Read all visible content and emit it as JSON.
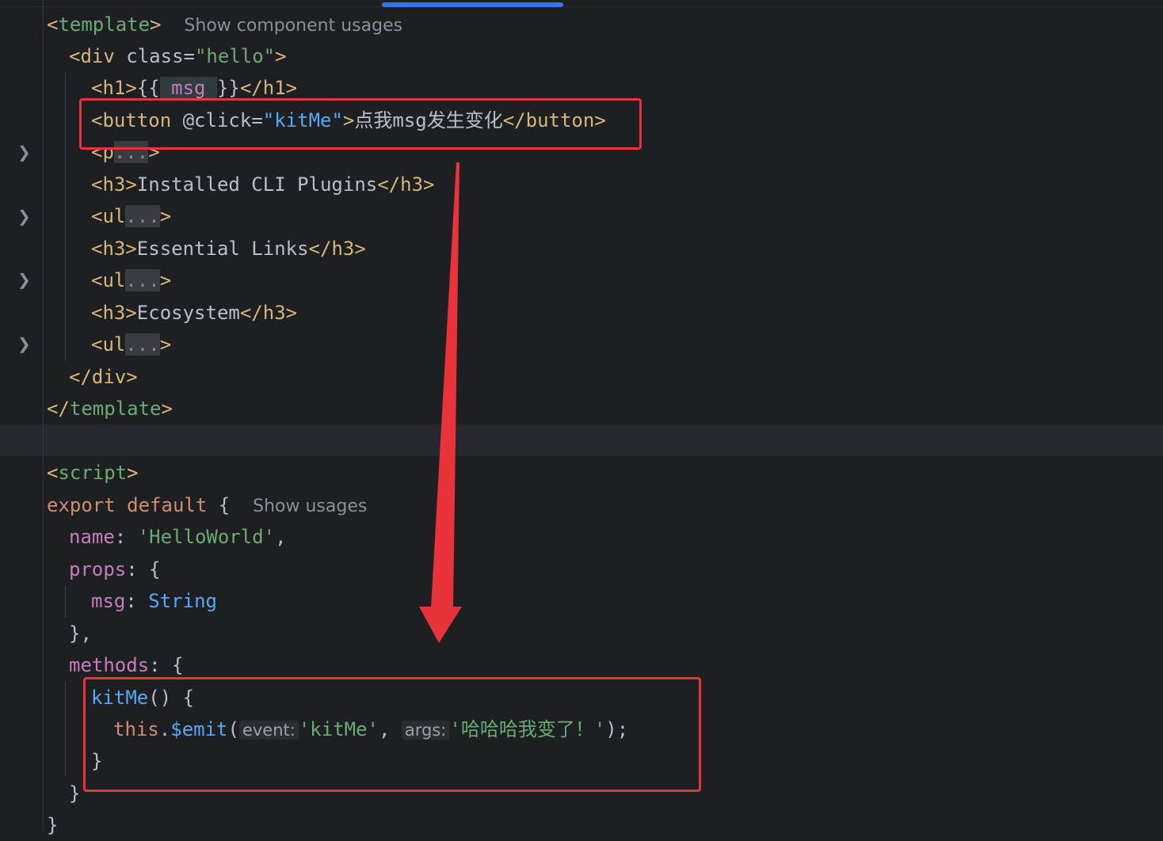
{
  "template_block": {
    "open_tag": "template",
    "hint": "Show component usages",
    "div_tag": "div",
    "div_attr": "class",
    "div_attr_value": "\"hello\"",
    "h1_open": "<h1>",
    "h1_expr_open": "{{",
    "h1_var": "msg",
    "h1_expr_close": "}}",
    "h1_close": "</h1>",
    "button_tag": "button",
    "button_attr": "@click",
    "button_attr_value": "\"kitMe\"",
    "button_text": "点我msg发生变化",
    "button_close": "</button>",
    "p_fold": "<p",
    "ellipsis": "...",
    "h3_1": "Installed CLI Plugins",
    "ul_fold": "<ul",
    "h3_2": "Essential Links",
    "h3_3": "Ecosystem",
    "div_close": "</div>",
    "template_close": "template"
  },
  "script_block": {
    "open_tag": "script",
    "export_kw": "export",
    "default_kw": "default",
    "hint": "Show usages",
    "name_key": "name",
    "name_value": "'HelloWorld'",
    "props_key": "props",
    "msg_key": "msg",
    "msg_type": "String",
    "methods_key": "methods",
    "method_name": "kitMe",
    "this_kw": "this",
    "emit_fn": "$emit",
    "inlay_event": "event:",
    "emit_event": "'kitMe'",
    "inlay_args": "args:",
    "emit_args": "'哈哈哈我变了！'"
  },
  "colors": {
    "annotation_red": "#e8333a",
    "scroll_indicator": "#3574f0"
  },
  "icons": [
    "fold-chevron-icon"
  ]
}
